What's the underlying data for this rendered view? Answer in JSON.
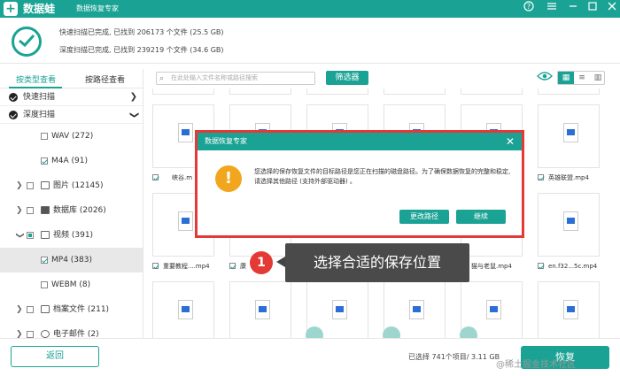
{
  "app": {
    "name": "数据蛙",
    "subtitle": "数据恢复专家",
    "logo_glyph": "+"
  },
  "titlebar_icons": [
    "help-icon",
    "menu-icon",
    "minimize-icon",
    "restore-icon",
    "close-icon"
  ],
  "header": {
    "quick_status": "快速扫描已完成, 已找到  206173 个文件  (25.5 GB)",
    "deep_status": "深度扫描已完成, 已找到  239219 个文件  (34.6 GB)"
  },
  "left": {
    "tabs": [
      "按类型查看",
      "按路径查看"
    ],
    "quick_scan": "快速扫描",
    "deep_scan": "深度扫描",
    "tree": [
      {
        "label": "WAV (272)"
      },
      {
        "label": "M4A (91)"
      },
      {
        "label": "图片 (12145)"
      },
      {
        "label": "数据库 (2026)"
      },
      {
        "label": "视频 (391)"
      },
      {
        "label": "MP4 (383)"
      },
      {
        "label": "WEBM (8)"
      },
      {
        "label": "档案文件 (211)"
      },
      {
        "label": "电子邮件 (2)"
      }
    ]
  },
  "toolbar": {
    "search_placeholder": "在此处输入文件名称或路径搜索",
    "filter": "筛选器"
  },
  "grid": {
    "labels_row1": [
      "峡谷.m",
      "",
      "",
      "",
      "",
      "",
      "英雄联盟.mp4"
    ],
    "labels_row2": [
      "重要教程....mp4",
      "康",
      "",
      "",
      "猫与老鼠.mp4",
      "en.f32...5c.mp4"
    ],
    "top_cut_labels": [
      "",
      "",
      "",
      "",
      "",
      "",
      ""
    ]
  },
  "dialog": {
    "title": "数据恢复专家",
    "message": "您选择的保存恢复文件的目标路径是您正在扫描的磁盘路径。为了确保数据恢复的完整和稳定, 请选择其他路径 (支持外部驱动器) 。",
    "change_path": "更改路径",
    "continue": "继续"
  },
  "callout": {
    "number": "1",
    "text": "选择合适的保存位置"
  },
  "bottom": {
    "back": "返回",
    "selected": "已选择 741个项目/ 3.11 GB",
    "recover": "恢复",
    "watermark": "@稀土掘金技术社区"
  }
}
